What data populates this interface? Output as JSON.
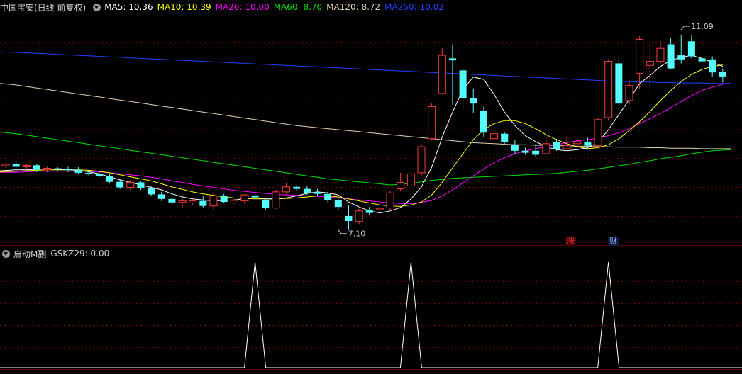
{
  "main_header": {
    "title": "中国宝安(日线 前复权)",
    "ma5": "MA5: 10.36",
    "ma10": "MA10: 10.39",
    "ma20": "MA20: 10.00",
    "ma60": "MA60: 8.70",
    "ma120": "MA120: 8.72",
    "ma250": "MA250: 10.02"
  },
  "sub_header": {
    "title": "启动M副",
    "value": "GSKZ29: 0.00"
  },
  "tags": {
    "zhang": "涨",
    "cai": "财"
  },
  "colors": {
    "up": "#ff3b3b",
    "down": "#54ffff",
    "ma5": "#ffffff",
    "ma10": "#ffff00",
    "ma20": "#ff00ff",
    "ma60": "#00e000",
    "ma120": "#e0d0b0",
    "ma250": "#2040ff",
    "grid": "#7a0000"
  },
  "chart_data": [
    {
      "type": "candlestick",
      "price_range": [
        6.8,
        11.4
      ],
      "annotations": [
        {
          "text": "11.09",
          "index": 65,
          "price": 11.09
        },
        {
          "text": "7.10",
          "index": 32,
          "price": 7.1
        }
      ],
      "candles": [
        [
          8.38,
          8.44,
          8.34,
          8.41
        ],
        [
          8.41,
          8.48,
          8.33,
          8.36
        ],
        [
          8.36,
          8.42,
          8.3,
          8.39
        ],
        [
          8.39,
          8.42,
          8.26,
          8.3
        ],
        [
          8.3,
          8.36,
          8.25,
          8.33
        ],
        [
          8.33,
          8.35,
          8.28,
          8.31
        ],
        [
          8.31,
          8.36,
          8.26,
          8.3
        ],
        [
          8.3,
          8.35,
          8.22,
          8.24
        ],
        [
          8.24,
          8.3,
          8.18,
          8.21
        ],
        [
          8.21,
          8.27,
          8.15,
          8.17
        ],
        [
          8.17,
          8.22,
          8.03,
          8.06
        ],
        [
          8.06,
          8.12,
          7.92,
          7.95
        ],
        [
          7.95,
          8.1,
          7.9,
          8.05
        ],
        [
          8.05,
          8.08,
          7.9,
          7.93
        ],
        [
          7.93,
          7.98,
          7.78,
          7.81
        ],
        [
          7.81,
          7.86,
          7.68,
          7.72
        ],
        [
          7.72,
          7.74,
          7.62,
          7.65
        ],
        [
          7.65,
          7.73,
          7.55,
          7.68
        ],
        [
          7.64,
          7.72,
          7.61,
          7.68
        ],
        [
          7.68,
          7.78,
          7.55,
          7.58
        ],
        [
          7.58,
          7.85,
          7.52,
          7.78
        ],
        [
          7.78,
          7.82,
          7.64,
          7.66
        ],
        [
          7.64,
          7.72,
          7.62,
          7.69
        ],
        [
          7.68,
          7.82,
          7.62,
          7.8
        ],
        [
          7.79,
          7.88,
          7.72,
          7.75
        ],
        [
          7.7,
          7.74,
          7.5,
          7.54
        ],
        [
          7.54,
          7.9,
          7.52,
          7.86
        ],
        [
          7.86,
          8.04,
          7.82,
          7.96
        ],
        [
          7.96,
          8.0,
          7.88,
          7.92
        ],
        [
          7.92,
          7.98,
          7.8,
          7.84
        ],
        [
          7.86,
          7.92,
          7.78,
          7.82
        ],
        [
          7.82,
          7.86,
          7.65,
          7.7
        ],
        [
          7.7,
          7.72,
          7.5,
          7.56
        ],
        [
          7.38,
          7.6,
          7.1,
          7.28
        ],
        [
          7.27,
          7.52,
          7.22,
          7.48
        ],
        [
          7.5,
          7.56,
          7.4,
          7.44
        ],
        [
          7.52,
          7.6,
          7.48,
          7.54
        ],
        [
          7.54,
          7.88,
          7.48,
          7.84
        ],
        [
          7.92,
          8.24,
          7.88,
          8.05
        ],
        [
          7.98,
          8.25,
          7.95,
          8.22
        ],
        [
          8.24,
          8.8,
          8.18,
          8.76
        ],
        [
          8.92,
          9.62,
          8.88,
          9.56
        ],
        [
          9.82,
          10.72,
          9.8,
          10.58
        ],
        [
          10.52,
          10.8,
          9.6,
          10.48
        ],
        [
          10.28,
          10.32,
          9.52,
          9.72
        ],
        [
          9.72,
          9.92,
          9.44,
          9.62
        ],
        [
          9.48,
          9.56,
          8.96,
          9.04
        ],
        [
          8.92,
          9.06,
          8.86,
          9.02
        ],
        [
          9.02,
          9.06,
          8.82,
          8.86
        ],
        [
          8.8,
          8.9,
          8.62,
          8.68
        ],
        [
          8.68,
          8.74,
          8.6,
          8.64
        ],
        [
          8.68,
          8.82,
          8.56,
          8.6
        ],
        [
          8.62,
          8.96,
          8.6,
          8.82
        ],
        [
          8.86,
          8.92,
          8.68,
          8.72
        ],
        [
          8.72,
          8.98,
          8.68,
          8.78
        ],
        [
          8.82,
          8.92,
          8.78,
          8.86
        ],
        [
          8.86,
          8.94,
          8.7,
          8.78
        ],
        [
          8.78,
          9.34,
          8.74,
          9.3
        ],
        [
          9.34,
          10.5,
          9.28,
          10.46
        ],
        [
          10.42,
          10.6,
          9.6,
          9.62
        ],
        [
          9.68,
          10.08,
          9.6,
          9.98
        ],
        [
          10.22,
          10.96,
          9.92,
          10.9
        ],
        [
          10.38,
          10.84,
          9.9,
          10.46
        ],
        [
          10.46,
          10.86,
          10.4,
          10.72
        ],
        [
          10.8,
          10.92,
          10.3,
          10.32
        ],
        [
          10.58,
          10.98,
          10.42,
          10.5
        ],
        [
          10.86,
          10.98,
          10.52,
          10.56
        ],
        [
          10.52,
          10.62,
          10.36,
          10.46
        ],
        [
          10.5,
          10.56,
          10.16,
          10.24
        ],
        [
          10.25,
          10.32,
          10.04,
          10.16
        ]
      ],
      "ma_lines": {
        "ma5": [
          8.28,
          8.3,
          8.3,
          8.31,
          8.32,
          8.31,
          8.3,
          8.29,
          8.26,
          8.22,
          8.16,
          8.1,
          8.05,
          8.0,
          7.95,
          7.9,
          7.82,
          7.76,
          7.72,
          7.7,
          7.68,
          7.69,
          7.7,
          7.72,
          7.74,
          7.72,
          7.72,
          7.74,
          7.78,
          7.83,
          7.86,
          7.84,
          7.8,
          7.66,
          7.56,
          7.48,
          7.44,
          7.48,
          7.55,
          7.72,
          7.96,
          8.35,
          8.95,
          9.45,
          9.9,
          10.15,
          10.1,
          9.8,
          9.45,
          9.18,
          8.98,
          8.86,
          8.76,
          8.7,
          8.68,
          8.7,
          8.74,
          8.85,
          9.1,
          9.4,
          9.7,
          10.02,
          10.18,
          10.36,
          10.48,
          10.54,
          10.58,
          10.52,
          10.44,
          10.36
        ],
        "ma10": [
          8.26,
          8.27,
          8.28,
          8.29,
          8.3,
          8.3,
          8.3,
          8.3,
          8.29,
          8.27,
          8.24,
          8.2,
          8.16,
          8.12,
          8.08,
          8.02,
          7.96,
          7.91,
          7.86,
          7.82,
          7.79,
          7.76,
          7.74,
          7.73,
          7.72,
          7.72,
          7.72,
          7.73,
          7.74,
          7.76,
          7.78,
          7.78,
          7.76,
          7.72,
          7.68,
          7.64,
          7.6,
          7.58,
          7.57,
          7.6,
          7.66,
          7.8,
          8.05,
          8.34,
          8.62,
          8.9,
          9.1,
          9.22,
          9.28,
          9.28,
          9.22,
          9.12,
          9.0,
          8.9,
          8.82,
          8.76,
          8.72,
          8.74,
          8.8,
          8.92,
          9.08,
          9.26,
          9.46,
          9.68,
          9.88,
          10.06,
          10.2,
          10.3,
          10.36,
          10.39
        ],
        "ma20": [
          8.25,
          8.25,
          8.26,
          8.27,
          8.27,
          8.27,
          8.27,
          8.27,
          8.27,
          8.26,
          8.24,
          8.22,
          8.2,
          8.18,
          8.15,
          8.12,
          8.08,
          8.05,
          8.01,
          7.98,
          7.95,
          7.92,
          7.89,
          7.87,
          7.85,
          7.83,
          7.81,
          7.8,
          7.79,
          7.78,
          7.77,
          7.76,
          7.74,
          7.72,
          7.7,
          7.68,
          7.66,
          7.64,
          7.63,
          7.63,
          7.65,
          7.69,
          7.78,
          7.9,
          8.04,
          8.18,
          8.32,
          8.44,
          8.54,
          8.62,
          8.68,
          8.72,
          8.76,
          8.8,
          8.84,
          8.88,
          8.9,
          8.93,
          8.98,
          9.04,
          9.12,
          9.22,
          9.32,
          9.42,
          9.54,
          9.66,
          9.78,
          9.88,
          9.95,
          10.0
        ],
        "ma60": [
          9.05,
          9.02,
          8.99,
          8.96,
          8.93,
          8.9,
          8.87,
          8.84,
          8.81,
          8.78,
          8.75,
          8.72,
          8.69,
          8.66,
          8.63,
          8.6,
          8.57,
          8.54,
          8.51,
          8.48,
          8.45,
          8.42,
          8.39,
          8.36,
          8.33,
          8.3,
          8.27,
          8.24,
          8.21,
          8.18,
          8.15,
          8.12,
          8.1,
          8.08,
          8.06,
          8.04,
          8.02,
          8.0,
          8.01,
          8.03,
          8.06,
          8.09,
          8.11,
          8.13,
          8.14,
          8.15,
          8.16,
          8.17,
          8.18,
          8.19,
          8.2,
          8.21,
          8.22,
          8.23,
          8.25,
          8.27,
          8.29,
          8.32,
          8.35,
          8.38,
          8.41,
          8.45,
          8.48,
          8.52,
          8.55,
          8.58,
          8.62,
          8.65,
          8.68,
          8.7
        ],
        "ma120": [
          10.02,
          9.99,
          9.96,
          9.93,
          9.9,
          9.87,
          9.84,
          9.81,
          9.78,
          9.75,
          9.72,
          9.69,
          9.66,
          9.63,
          9.6,
          9.57,
          9.54,
          9.51,
          9.48,
          9.45,
          9.42,
          9.39,
          9.36,
          9.33,
          9.3,
          9.27,
          9.24,
          9.21,
          9.18,
          9.16,
          9.14,
          9.12,
          9.1,
          9.08,
          9.06,
          9.04,
          9.02,
          9.0,
          8.98,
          8.96,
          8.94,
          8.92,
          8.9,
          8.88,
          8.86,
          8.84,
          8.83,
          8.82,
          8.81,
          8.8,
          8.8,
          8.79,
          8.79,
          8.78,
          8.78,
          8.77,
          8.77,
          8.76,
          8.76,
          8.75,
          8.75,
          8.75,
          8.74,
          8.74,
          8.73,
          8.73,
          8.73,
          8.72,
          8.72,
          8.72
        ],
        "ma250": [
          10.65,
          10.64,
          10.63,
          10.62,
          10.61,
          10.6,
          10.59,
          10.58,
          10.57,
          10.56,
          10.55,
          10.54,
          10.53,
          10.52,
          10.51,
          10.5,
          10.49,
          10.48,
          10.47,
          10.46,
          10.45,
          10.44,
          10.43,
          10.42,
          10.41,
          10.4,
          10.39,
          10.38,
          10.37,
          10.36,
          10.35,
          10.34,
          10.33,
          10.32,
          10.31,
          10.3,
          10.29,
          10.28,
          10.27,
          10.26,
          10.25,
          10.24,
          10.23,
          10.22,
          10.21,
          10.2,
          10.19,
          10.18,
          10.17,
          10.16,
          10.15,
          10.14,
          10.13,
          10.12,
          10.11,
          10.1,
          10.09,
          10.08,
          10.07,
          10.06,
          10.06,
          10.05,
          10.05,
          10.04,
          10.04,
          10.03,
          10.03,
          10.03,
          10.02,
          10.02
        ]
      }
    },
    {
      "type": "line",
      "name": "GSKZ29",
      "y_range": [
        0,
        1
      ],
      "spikes": [
        24,
        39,
        58
      ]
    }
  ]
}
